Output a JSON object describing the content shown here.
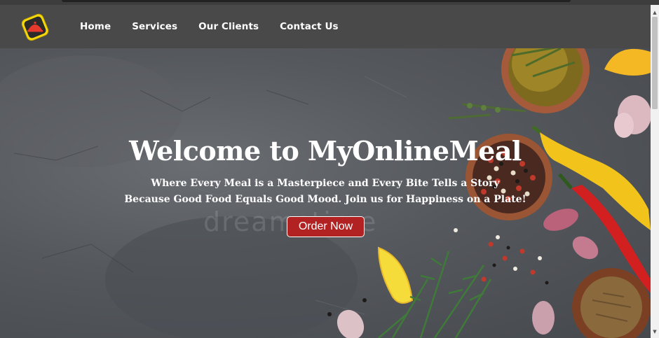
{
  "nav": {
    "logo_icon": "food-cloche-icon",
    "links": [
      "Home",
      "Services",
      "Our Clients",
      "Contact Us"
    ]
  },
  "hero": {
    "title": "Welcome to MyOnlineMeal",
    "tagline_1": "Where Every Meal is a Masterpiece and Every Bite Tells a Story",
    "tagline_2": "Because Good Food Equals Good Mood. Join us for Happiness on a Plate!",
    "button_label": "Order Now",
    "watermark": "dreamstime"
  },
  "colors": {
    "navbar": "#494949",
    "button": "#b22222",
    "logo_yellow": "#f5d90a",
    "logo_red": "#e63a2e"
  },
  "scrollbar": {
    "up_icon": "scroll-up-arrow-icon",
    "down_icon": "scroll-down-arrow-icon"
  }
}
